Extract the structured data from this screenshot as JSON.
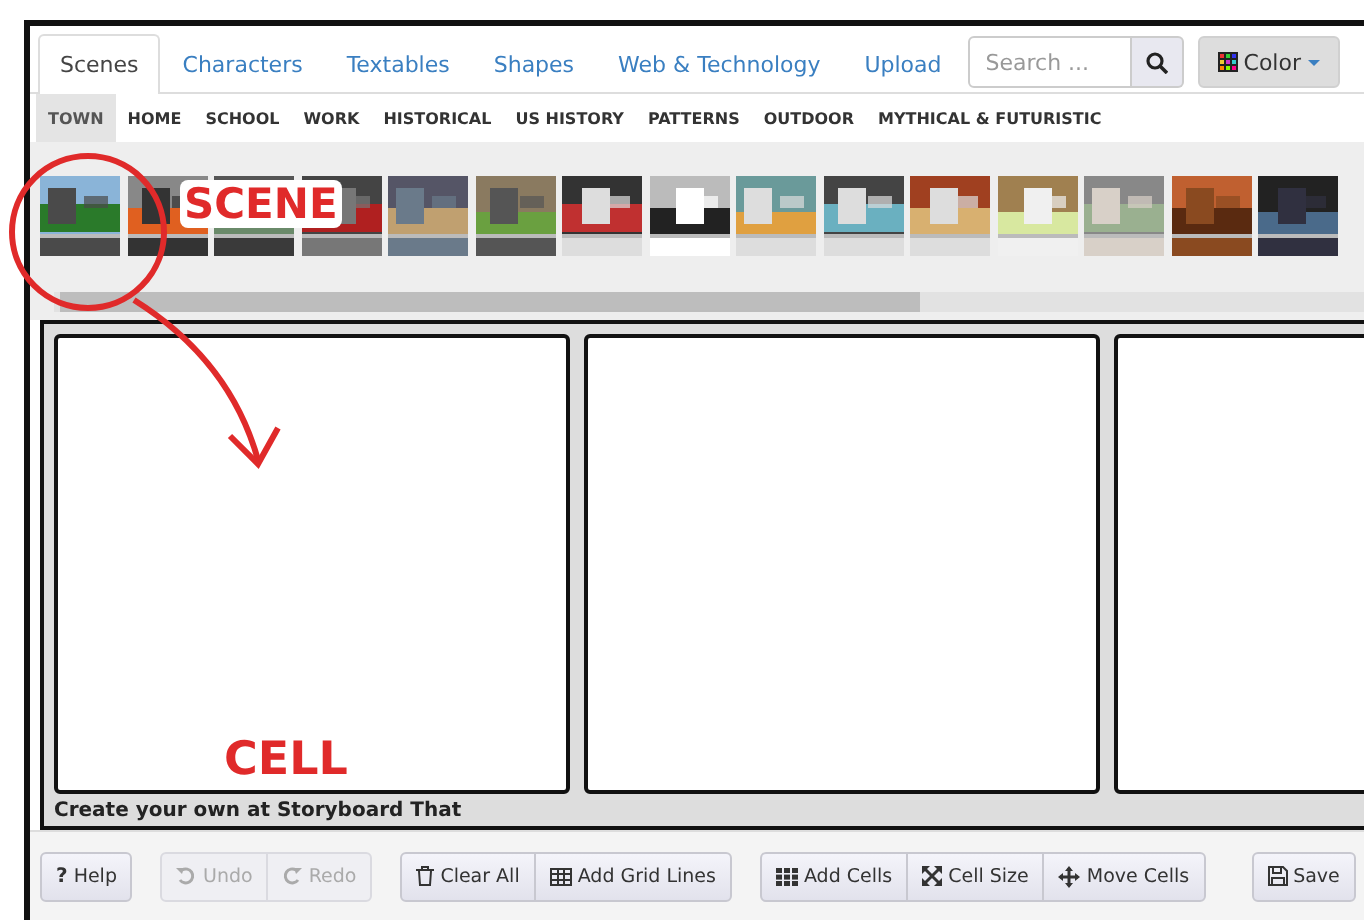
{
  "tabs": [
    {
      "label": "Scenes",
      "selected": true
    },
    {
      "label": "Characters",
      "selected": false
    },
    {
      "label": "Textables",
      "selected": false
    },
    {
      "label": "Shapes",
      "selected": false
    },
    {
      "label": "Web & Technology",
      "selected": false
    },
    {
      "label": "Upload",
      "selected": false
    }
  ],
  "search": {
    "placeholder": "Search ..."
  },
  "color_button": {
    "label": "Color"
  },
  "categories": [
    {
      "label": "TOWN",
      "selected": true
    },
    {
      "label": "HOME",
      "selected": false
    },
    {
      "label": "SCHOOL",
      "selected": false
    },
    {
      "label": "WORK",
      "selected": false
    },
    {
      "label": "HISTORICAL",
      "selected": false
    },
    {
      "label": "US HISTORY",
      "selected": false
    },
    {
      "label": "PATTERNS",
      "selected": false
    },
    {
      "label": "OUTDOOR",
      "selected": false
    },
    {
      "label": "MYTHICAL & FUTURISTIC",
      "selected": false
    }
  ],
  "thumbnails": [
    {
      "kind": "picture"
    },
    {
      "kind": "picture"
    },
    {
      "kind": "picture"
    },
    {
      "kind": "picture"
    },
    {
      "kind": "picture"
    },
    {
      "kind": "picture"
    },
    {
      "kind": "picture"
    },
    {
      "kind": "picture"
    },
    {
      "kind": "picture"
    },
    {
      "kind": "picture"
    },
    {
      "kind": "picture"
    },
    {
      "kind": "picture"
    },
    {
      "kind": "picture"
    },
    {
      "kind": "picture"
    },
    {
      "kind": "picture"
    }
  ],
  "cells": [
    {
      "kind": "cell"
    },
    {
      "kind": "cell"
    },
    {
      "kind": "cell"
    }
  ],
  "footer_note": "Create your own at Storyboard That",
  "toolbar": [
    [
      {
        "label": "Help",
        "kind": "help",
        "icon": "?",
        "disabled": false
      }
    ],
    [
      {
        "label": "Undo",
        "kind": "undo",
        "disabled": true
      },
      {
        "label": "Redo",
        "kind": "redo",
        "disabled": true
      }
    ],
    [
      {
        "label": "Clear All",
        "kind": "trash",
        "disabled": false
      },
      {
        "label": "Add Grid Lines",
        "kind": "grid",
        "disabled": false
      }
    ],
    [
      {
        "label": "Add Cells",
        "kind": "cells",
        "disabled": false
      },
      {
        "label": "Cell Size",
        "kind": "resize",
        "disabled": false
      },
      {
        "label": "Move Cells",
        "kind": "move",
        "disabled": false
      }
    ],
    [
      {
        "label": "Save",
        "kind": "save",
        "disabled": false
      }
    ]
  ],
  "annotations": [
    {
      "kind": "circle"
    },
    {
      "kind": "arrow"
    },
    {
      "kind": "label",
      "text": "SCENE"
    },
    {
      "kind": "label",
      "text": "CELL"
    }
  ]
}
